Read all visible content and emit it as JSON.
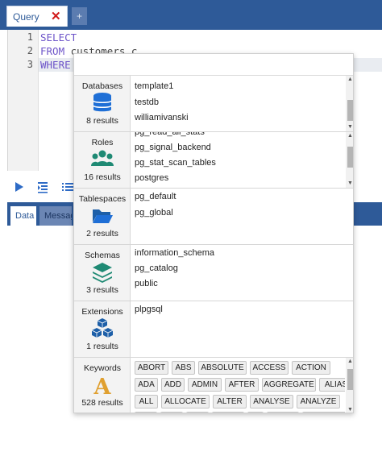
{
  "tabs": {
    "query_label": "Query",
    "close_glyph": "✕",
    "add_glyph": "+"
  },
  "editor": {
    "line_numbers": [
      "1",
      "2",
      "3"
    ],
    "lines": [
      "SELECT",
      "FROM customers c",
      "WHERE"
    ]
  },
  "result_tabs": {
    "data_label": "Data",
    "messages_label": "Messages"
  },
  "autocomplete": {
    "sections": [
      {
        "title": "Databases",
        "count_label": "8 results",
        "icon": "database-icon",
        "items": [
          "template1",
          "testdb",
          "williamivanski"
        ]
      },
      {
        "title": "Roles",
        "count_label": "16 results",
        "icon": "users-icon",
        "items": [
          "pg_read_all_stats",
          "pg_signal_backend",
          "pg_stat_scan_tables",
          "postgres"
        ]
      },
      {
        "title": "Tablespaces",
        "count_label": "2 results",
        "icon": "folder-icon",
        "items": [
          "pg_default",
          "pg_global"
        ]
      },
      {
        "title": "Schemas",
        "count_label": "3 results",
        "icon": "layers-icon",
        "items": [
          "information_schema",
          "pg_catalog",
          "public"
        ]
      },
      {
        "title": "Extensions",
        "count_label": "1 results",
        "icon": "cubes-icon",
        "items": [
          "plpgsql"
        ]
      },
      {
        "title": "Keywords",
        "count_label": "528 results",
        "icon": "letter-a-icon",
        "keyword_rows": [
          [
            "ABORT",
            "ABS",
            "ABSOLUTE",
            "ACCESS",
            "ACTION"
          ],
          [
            "ADA",
            "ADD",
            "ADMIN",
            "AFTER",
            "AGGREGATE",
            "ALIAS"
          ],
          [
            "ALL",
            "ALLOCATE",
            "ALTER",
            "ANALYSE",
            "ANALYZE"
          ]
        ]
      }
    ]
  },
  "colors": {
    "header_blue": "#2e5a98",
    "keyword_purple": "#6e55c9",
    "icon_blue": "#1f6fd6",
    "icon_teal": "#1f8a74",
    "icon_orange": "#e0a030"
  }
}
